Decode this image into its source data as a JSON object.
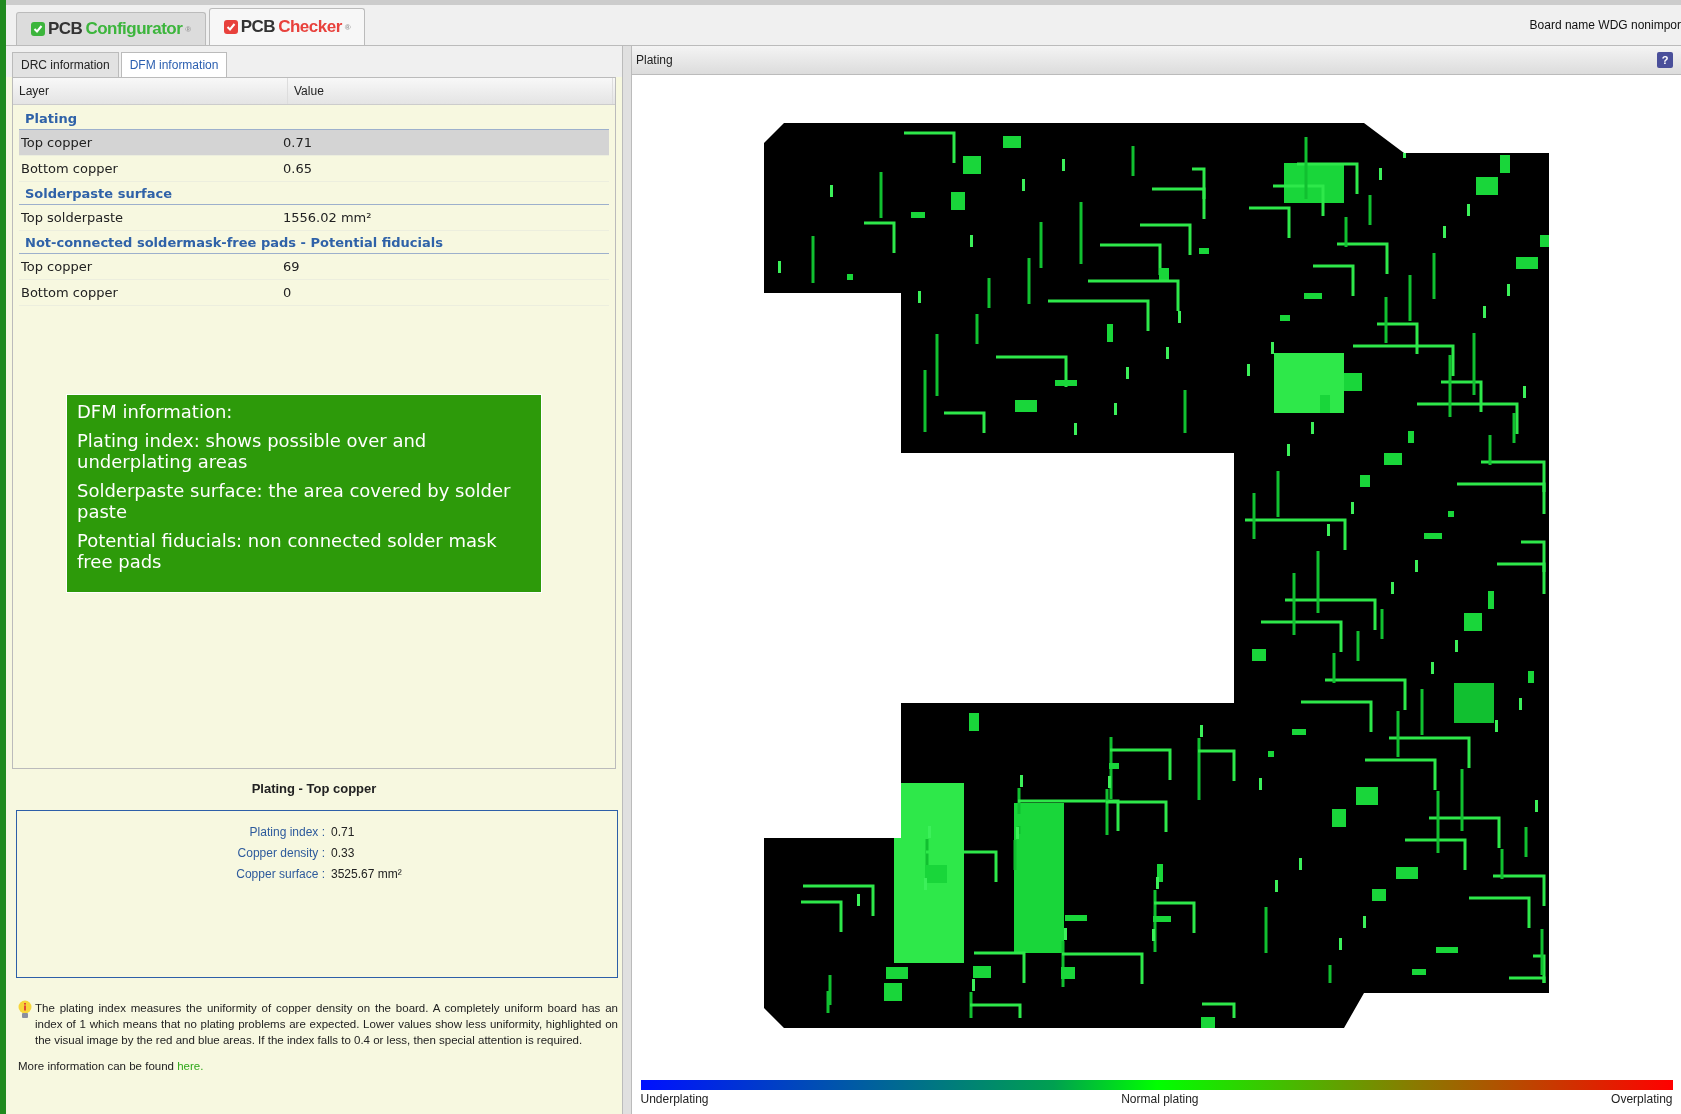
{
  "app_tabs": [
    {
      "brand": "PCB",
      "product": "Configurator",
      "mark": "®",
      "color": "#3cb53c",
      "selected": false
    },
    {
      "brand": "PCB",
      "product": "Checker",
      "mark": "®",
      "color": "#e8413c",
      "selected": true
    }
  ],
  "board_name": "Board name WDG nonimpor",
  "info_tabs": [
    {
      "label": "DRC information",
      "selected": false
    },
    {
      "label": "DFM information",
      "selected": true
    }
  ],
  "table": {
    "columns": [
      "Layer",
      "Value"
    ],
    "rows": [
      {
        "kind": "group",
        "layer": "Plating",
        "selected": false
      },
      {
        "kind": "row",
        "layer": "Top copper",
        "value": "0.71",
        "selected": true
      },
      {
        "kind": "row",
        "layer": "Bottom copper",
        "value": "0.65",
        "selected": false
      },
      {
        "kind": "group",
        "layer": "Solderpaste surface",
        "selected": false
      },
      {
        "kind": "row",
        "layer": "Top solderpaste",
        "value": "1556.02 mm²",
        "selected": false
      },
      {
        "kind": "group",
        "layer": "Not-connected soldermask-free pads - Potential fiducials",
        "selected": false
      },
      {
        "kind": "row",
        "layer": "Top copper",
        "value": "69",
        "selected": false
      },
      {
        "kind": "row",
        "layer": "Bottom copper",
        "value": "0",
        "selected": false
      }
    ]
  },
  "callout": {
    "title": "DFM information:",
    "paragraphs": [
      "Plating index: shows possible over and underplating areas",
      "Solderpaste surface: the area covered by solder paste",
      "Potential fiducials: non connected solder mask free pads"
    ]
  },
  "detail": {
    "title": "Plating - Top copper",
    "metrics": [
      {
        "label": "Plating index :",
        "value": "0.71"
      },
      {
        "label": "Copper density :",
        "value": "0.33"
      },
      {
        "label": "Copper surface :",
        "value": "3525.67 mm²"
      }
    ]
  },
  "note": "The plating index measures the uniformity of copper density on the board. A completely uniform board has an index of 1 which means that no plating problems are expected. Lower values show less uniformity, highlighted on the visual image by the red and blue areas. If the index falls to 0.4 or less, then special attention is required.",
  "more_info": {
    "text": "More information can be found ",
    "link": "here."
  },
  "viewer": {
    "title": "Plating",
    "help": "?",
    "legend": [
      "Underplating",
      "Normal plating",
      "Overplating"
    ]
  }
}
